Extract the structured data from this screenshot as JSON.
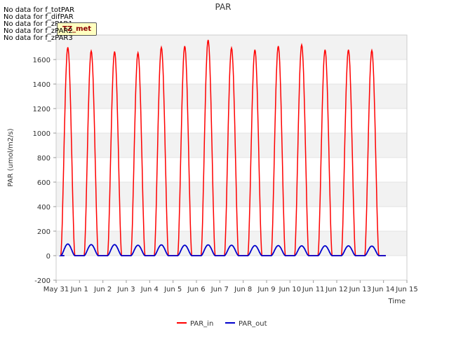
{
  "chart_data": {
    "type": "line",
    "title": "PAR",
    "xlabel": "Time",
    "ylabel": "PAR (umol/m2/s)",
    "ylim": [
      -200,
      1800
    ],
    "yticks": [
      -200,
      0,
      200,
      400,
      600,
      800,
      1000,
      1200,
      1400,
      1600
    ],
    "xlim": [
      0,
      15
    ],
    "xtick_labels": [
      "May 31",
      "Jun 1",
      "Jun 2",
      "Jun 3",
      "Jun 4",
      "Jun 5",
      "Jun 6",
      "Jun 7",
      "Jun 8",
      "Jun 9",
      "Jun 10",
      "Jun 11",
      "Jun 12",
      "Jun 13",
      "Jun 14",
      "Jun 15"
    ],
    "grid": true,
    "legend_position": "bottom-center",
    "no_data_messages": [
      "No data for f_totPAR",
      "No data for f_difPAR",
      "No data for f_zPAR1",
      "No data for f_zPAR2",
      "No data for f_zPAR3"
    ],
    "badge_label": "TZ_met",
    "series": [
      {
        "name": "PAR_in",
        "color": "#ff0000",
        "daily_peaks": [
          1700,
          1670,
          1665,
          1655,
          1700,
          1710,
          1760,
          1695,
          1680,
          1710,
          1720,
          1680,
          1680,
          1675
        ],
        "sunrise_offset": 0.2,
        "sunset_offset": 0.8
      },
      {
        "name": "PAR_out",
        "color": "#0000cc",
        "daily_peaks": [
          95,
          90,
          90,
          85,
          88,
          85,
          88,
          85,
          82,
          82,
          80,
          80,
          80,
          78
        ],
        "sunrise_offset": 0.2,
        "sunset_offset": 0.8
      }
    ]
  }
}
